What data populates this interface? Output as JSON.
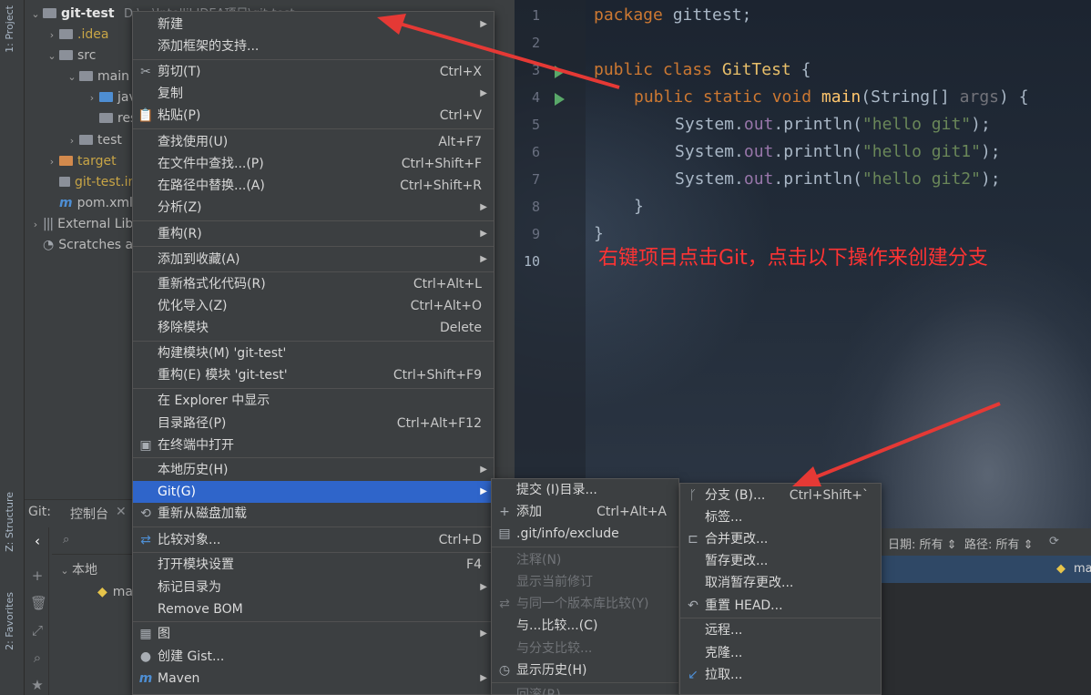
{
  "strip": {
    "project_tab": "1: Project",
    "structure_tab": "Z: Structure",
    "favorites_tab": "2: Favorites"
  },
  "project_tree": {
    "root": "git-test",
    "root_path": "D:\\...\\IntelliJ IDEA项目\\git-test",
    "idea": ".idea",
    "src": "src",
    "main": "main",
    "java": "java",
    "resources": "resources",
    "test": "test",
    "target": "target",
    "iml": "git-test.iml",
    "pom": "pom.xml",
    "external": "External Libraries",
    "scratches": "Scratches and Consoles"
  },
  "editor": {
    "line_numbers": [
      "1",
      "2",
      "3",
      "4",
      "5",
      "6",
      "7",
      "8",
      "9",
      "10"
    ],
    "line1_kw": "package",
    "line1_rest": " gittest;",
    "line3_kw": "public class",
    "line3_cls": "GitTest",
    "line3_rest": " {",
    "line4_kw": "public static void",
    "line4_fn": "main",
    "line4_a": "(String[] ",
    "line4_param": "args",
    "line4_b": ") {",
    "sys": "System.",
    "out": "out",
    "println": ".println(",
    "str1": "\"hello git\"",
    "str2": "\"hello git1\"",
    "str3": "\"hello git2\"",
    "end": ");",
    "close_method": "}",
    "close_class": "}",
    "annotation": "右键项目点击Git，点击以下操作来创建分支"
  },
  "git_panel": {
    "tab_git": "Git:",
    "tab_console": "控制台",
    "local": "本地",
    "branch": "master"
  },
  "log_toolbar": {
    "date_filter": "日期: 所有 ⇕",
    "path_filter": "路径: 所有 ⇕",
    "branch_label": "master"
  },
  "context_menu": {
    "new": "新建",
    "add_framework": "添加框架的支持...",
    "cut": "剪切(T)",
    "cut_key": "Ctrl+X",
    "copy": "复制",
    "paste": "粘贴(P)",
    "paste_key": "Ctrl+V",
    "find_usages": "查找使用(U)",
    "find_usages_key": "Alt+F7",
    "find_in_files": "在文件中查找...(P)",
    "find_in_files_key": "Ctrl+Shift+F",
    "replace_in_path": "在路径中替换...(A)",
    "replace_in_path_key": "Ctrl+Shift+R",
    "analyze": "分析(Z)",
    "refactor": "重构(R)",
    "add_favorites": "添加到收藏(A)",
    "reformat": "重新格式化代码(R)",
    "reformat_key": "Ctrl+Alt+L",
    "optimize_imports": "优化导入(Z)",
    "optimize_imports_key": "Ctrl+Alt+O",
    "remove_module": "移除模块",
    "remove_module_key": "Delete",
    "build_module": "构建模块(M) 'git-test'",
    "rebuild_module": "重构(E) 模块 'git-test'",
    "rebuild_module_key": "Ctrl+Shift+F9",
    "show_in_explorer": "在 Explorer 中显示",
    "dir_path": "目录路径(P)",
    "dir_path_key": "Ctrl+Alt+F12",
    "open_terminal": "在终端中打开",
    "local_history": "本地历史(H)",
    "git": "Git(G)",
    "reload": "重新从磁盘加载",
    "compare_with": "比较对象...",
    "compare_with_key": "Ctrl+D",
    "module_settings": "打开模块设置",
    "module_settings_key": "F4",
    "mark_dir": "标记目录为",
    "remove_bom": "Remove BOM",
    "diagrams": "图",
    "create_gist": "创建 Gist...",
    "maven": "Maven"
  },
  "git_submenu": {
    "commit": "提交 (I)目录...",
    "add": "添加",
    "add_key": "Ctrl+Alt+A",
    "exclude": ".git/info/exclude",
    "annotate": "注释(N)",
    "show_revision": "显示当前修订",
    "compare_same": "与同一个版本库比较(Y)",
    "compare_with": "与...比较...(C)",
    "compare_branch": "与分支比较...",
    "show_history": "显示历史(H)",
    "more": "回滚(R)..."
  },
  "repo_submenu": {
    "branches": "分支 (B)...",
    "branches_key": "Ctrl+Shift+`",
    "tag": "标签...",
    "merge": "合并更改...",
    "stash": "暂存更改...",
    "unstash": "取消暂存更改...",
    "reset_head": "重置 HEAD...",
    "remotes": "远程...",
    "clone": "克隆...",
    "pull": "拉取..."
  },
  "colors": {
    "highlight": "#2f65ca",
    "annotation": "#ff3333",
    "arrow": "#e53935"
  }
}
